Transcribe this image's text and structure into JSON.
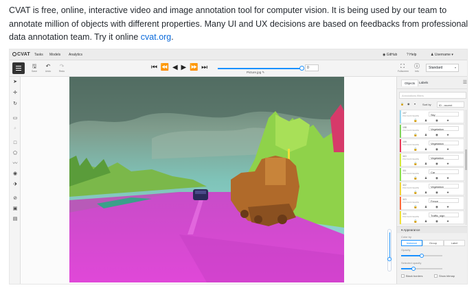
{
  "intro": {
    "text": "CVAT is free, online, interactive video and image annotation tool for computer vision. It is being used by our team to annotate million of objects with different properties. Many UI and UX decisions are based on feedbacks from professional data annotation team. Try it online ",
    "link_text": "cvat.org",
    "trail": "."
  },
  "app": {
    "logo": "CVAT",
    "nav": [
      "Tasks",
      "Models",
      "Analytics"
    ],
    "github": "GitHub",
    "help": "Help",
    "user": "Username"
  },
  "toolbar": {
    "save_label": "Save",
    "undo_label": "Undo",
    "redo_label": "Redo",
    "player_controls": "⏮ ⏪ ◀ ▶ ⏩ ⏭",
    "frame_value": "0",
    "filename": "Picture.jpg",
    "fullscreen_label": "Fullscreen",
    "info_label": "Info",
    "workspace": "Standard"
  },
  "panel": {
    "tabs": [
      "Objects",
      "Labels"
    ],
    "search_placeholder": "Annotations filters",
    "sort_label": "Sort by",
    "sort_value": "ID - ascent",
    "objects": [
      {
        "id": "107",
        "type": "POLYGON SHAPE",
        "label": "Sky",
        "color": "#9ad8f0"
      },
      {
        "id": "108",
        "type": "POLYGON SHAPE",
        "label": "Vegetation",
        "color": "#7fd45a"
      },
      {
        "id": "109",
        "type": "POLYGON SHAPE",
        "label": "Vegetation",
        "color": "#e83a5a"
      },
      {
        "id": "110",
        "type": "POLYGON SHAPE",
        "label": "Vegetation",
        "color": "#d4e83a"
      },
      {
        "id": "111",
        "type": "POLYGON SHAPE",
        "label": "Car",
        "color": "#8be04e"
      },
      {
        "id": "112",
        "type": "POLYGON SHAPE",
        "label": "Vegetation",
        "color": "#f0d43a"
      },
      {
        "id": "113",
        "type": "POLYGON SHAPE",
        "label": "Fence",
        "color": "#ff6b3a"
      },
      {
        "id": "114",
        "type": "POLYGON SHAPE",
        "label": "Traffic_sign",
        "color": "#f0e03a"
      }
    ],
    "appearance": "Appearance",
    "color_by_label": "Color by",
    "color_by_options": [
      "Instance",
      "Group",
      "Label"
    ],
    "color_by_selected": "Instance",
    "opacity_label": "Opacity",
    "opacity_value": 0.5,
    "selected_opacity_label": "Selected opacity",
    "selected_opacity_value": 0.3,
    "black_borders": "Black borders",
    "show_bitmap": "Show bitmap"
  }
}
